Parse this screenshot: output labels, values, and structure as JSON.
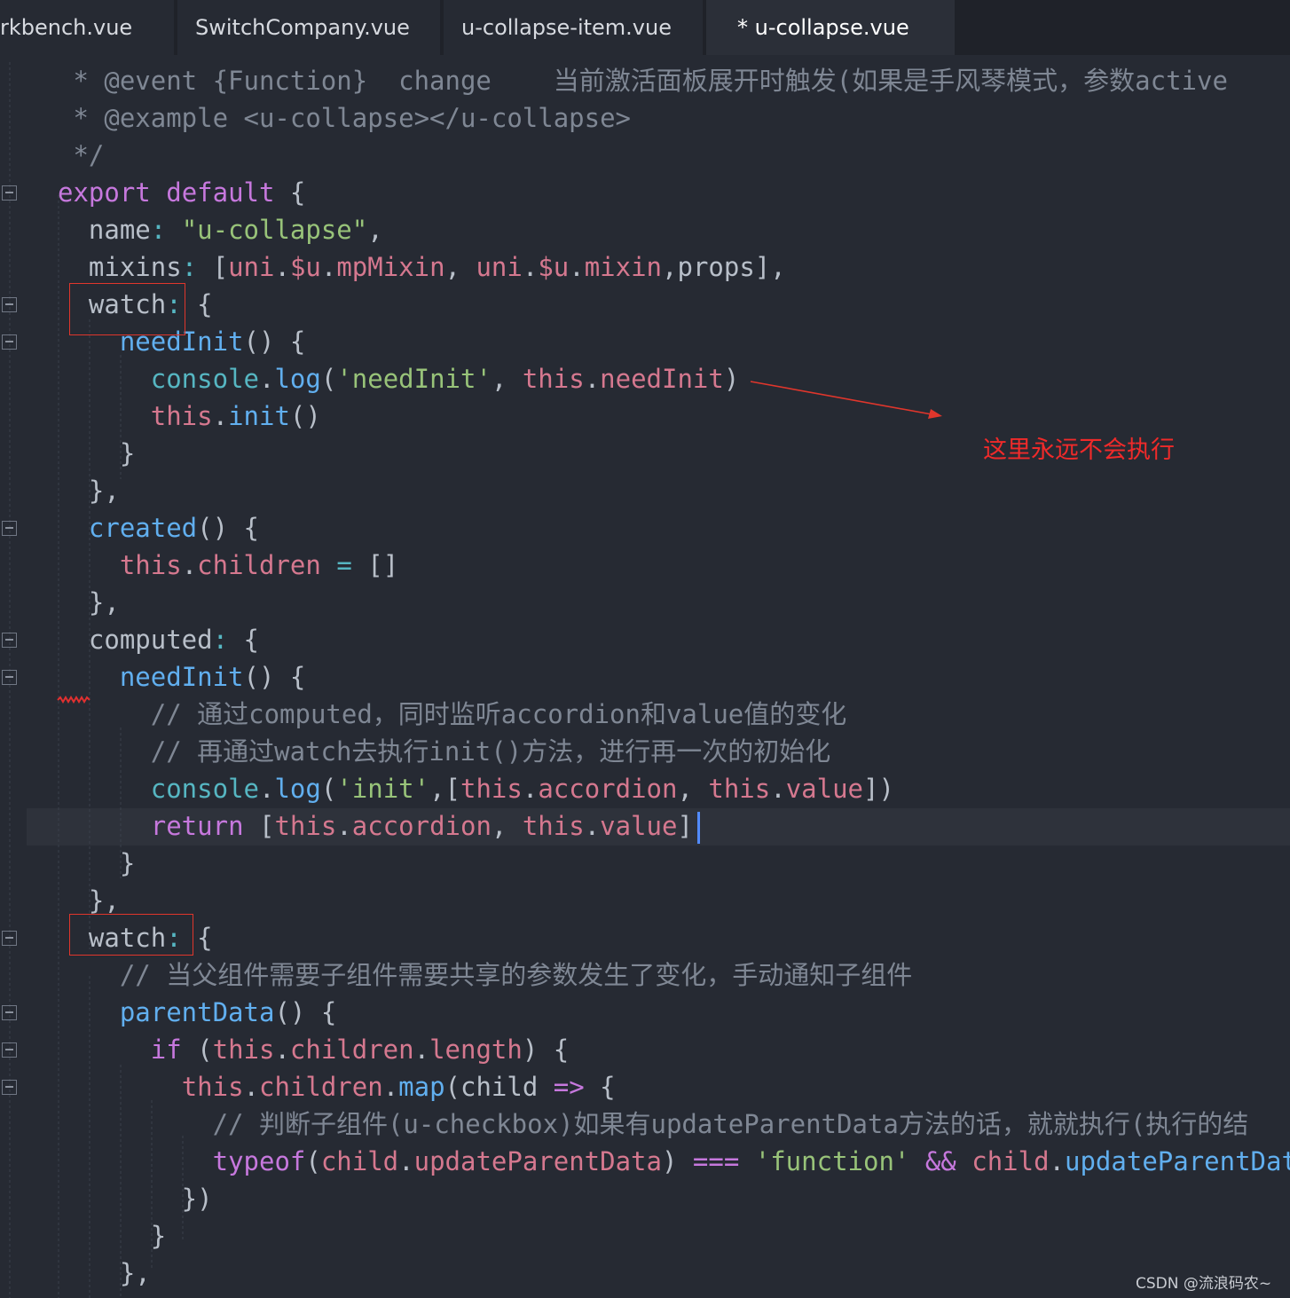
{
  "tabs": [
    {
      "label": "rkbench.vue",
      "active": false
    },
    {
      "label": "SwitchCompany.vue",
      "active": false
    },
    {
      "label": "u-collapse-item.vue",
      "active": false
    },
    {
      "label": "* u-collapse.vue",
      "active": true
    }
  ],
  "code_lines": [
    [
      [
        "com",
        " * @event {Function}  change    当前激活面板展开时触发(如果是手风琴模式，参数active"
      ]
    ],
    [
      [
        "com",
        " * @example <u-collapse></u-collapse>"
      ]
    ],
    [
      [
        "com",
        " */"
      ]
    ],
    [
      [
        "kw",
        "export"
      ],
      [
        "plain",
        " "
      ],
      [
        "kw",
        "default"
      ],
      [
        "plain",
        " {"
      ]
    ],
    [
      [
        "plain",
        "  name"
      ],
      [
        "cyan",
        ":"
      ],
      [
        "plain",
        " "
      ],
      [
        "str",
        "\"u-collapse\""
      ],
      [
        "plain",
        ","
      ]
    ],
    [
      [
        "plain",
        "  mixins"
      ],
      [
        "cyan",
        ":"
      ],
      [
        "plain",
        " ["
      ],
      [
        "var",
        "uni"
      ],
      [
        "plain",
        "."
      ],
      [
        "var",
        "$u"
      ],
      [
        "plain",
        "."
      ],
      [
        "var",
        "mpMixin"
      ],
      [
        "plain",
        ", "
      ],
      [
        "var",
        "uni"
      ],
      [
        "plain",
        "."
      ],
      [
        "var",
        "$u"
      ],
      [
        "plain",
        "."
      ],
      [
        "var",
        "mixin"
      ],
      [
        "plain",
        ",props],"
      ]
    ],
    [
      [
        "plain",
        "  watch"
      ],
      [
        "cyan",
        ":"
      ],
      [
        "plain",
        " {"
      ]
    ],
    [
      [
        "plain",
        "    "
      ],
      [
        "func",
        "needInit"
      ],
      [
        "plain",
        "() {"
      ]
    ],
    [
      [
        "plain",
        "      "
      ],
      [
        "cyan",
        "console"
      ],
      [
        "plain",
        "."
      ],
      [
        "func",
        "log"
      ],
      [
        "plain",
        "("
      ],
      [
        "str",
        "'needInit'"
      ],
      [
        "plain",
        ", "
      ],
      [
        "var",
        "this"
      ],
      [
        "plain",
        "."
      ],
      [
        "var",
        "needInit"
      ],
      [
        "plain",
        ")"
      ]
    ],
    [
      [
        "plain",
        "      "
      ],
      [
        "var",
        "this"
      ],
      [
        "plain",
        "."
      ],
      [
        "func",
        "init"
      ],
      [
        "plain",
        "()"
      ]
    ],
    [
      [
        "plain",
        "    }"
      ]
    ],
    [
      [
        "plain",
        "  },"
      ]
    ],
    [
      [
        "plain",
        "  "
      ],
      [
        "func",
        "created"
      ],
      [
        "plain",
        "() {"
      ]
    ],
    [
      [
        "plain",
        "    "
      ],
      [
        "var",
        "this"
      ],
      [
        "plain",
        "."
      ],
      [
        "var",
        "children"
      ],
      [
        "plain",
        " "
      ],
      [
        "cyan",
        "="
      ],
      [
        "plain",
        " []"
      ]
    ],
    [
      [
        "plain",
        "  },"
      ]
    ],
    [
      [
        "plain",
        "  computed"
      ],
      [
        "cyan",
        ":"
      ],
      [
        "plain",
        " {"
      ]
    ],
    [
      [
        "plain",
        "    "
      ],
      [
        "func",
        "needInit"
      ],
      [
        "plain",
        "() {"
      ]
    ],
    [
      [
        "com",
        "      // 通过computed，同时监听accordion和value值的变化"
      ]
    ],
    [
      [
        "com",
        "      // 再通过watch去执行init()方法，进行再一次的初始化"
      ]
    ],
    [
      [
        "plain",
        "      "
      ],
      [
        "cyan",
        "console"
      ],
      [
        "plain",
        "."
      ],
      [
        "func",
        "log"
      ],
      [
        "plain",
        "("
      ],
      [
        "str",
        "'init'"
      ],
      [
        "plain",
        ",["
      ],
      [
        "var",
        "this"
      ],
      [
        "plain",
        "."
      ],
      [
        "var",
        "accordion"
      ],
      [
        "plain",
        ", "
      ],
      [
        "var",
        "this"
      ],
      [
        "plain",
        "."
      ],
      [
        "var",
        "value"
      ],
      [
        "plain",
        "])"
      ]
    ],
    [
      [
        "plain",
        "      "
      ],
      [
        "kw",
        "return"
      ],
      [
        "plain",
        " ["
      ],
      [
        "var",
        "this"
      ],
      [
        "plain",
        "."
      ],
      [
        "var",
        "accordion"
      ],
      [
        "plain",
        ", "
      ],
      [
        "var",
        "this"
      ],
      [
        "plain",
        "."
      ],
      [
        "var",
        "value"
      ],
      [
        "plain",
        "]"
      ]
    ],
    [
      [
        "plain",
        "    }"
      ]
    ],
    [
      [
        "plain",
        "  },"
      ]
    ],
    [
      [
        "plain",
        "  watch"
      ],
      [
        "cyan",
        ":"
      ],
      [
        "plain",
        " {"
      ]
    ],
    [
      [
        "com",
        "    // 当父组件需要子组件需要共享的参数发生了变化，手动通知子组件"
      ]
    ],
    [
      [
        "plain",
        "    "
      ],
      [
        "func",
        "parentData"
      ],
      [
        "plain",
        "() {"
      ]
    ],
    [
      [
        "plain",
        "      "
      ],
      [
        "kw",
        "if"
      ],
      [
        "plain",
        " ("
      ],
      [
        "var",
        "this"
      ],
      [
        "plain",
        "."
      ],
      [
        "var",
        "children"
      ],
      [
        "plain",
        "."
      ],
      [
        "var",
        "length"
      ],
      [
        "plain",
        ") {"
      ]
    ],
    [
      [
        "plain",
        "        "
      ],
      [
        "var",
        "this"
      ],
      [
        "plain",
        "."
      ],
      [
        "var",
        "children"
      ],
      [
        "plain",
        "."
      ],
      [
        "func",
        "map"
      ],
      [
        "plain",
        "(child "
      ],
      [
        "op",
        "=>"
      ],
      [
        "plain",
        " {"
      ]
    ],
    [
      [
        "com",
        "          // 判断子组件(u-checkbox)如果有updateParentData方法的话，就就执行(执行的结"
      ]
    ],
    [
      [
        "plain",
        "          "
      ],
      [
        "kw",
        "typeof"
      ],
      [
        "plain",
        "("
      ],
      [
        "var",
        "child"
      ],
      [
        "plain",
        "."
      ],
      [
        "var",
        "updateParentData"
      ],
      [
        "plain",
        ") "
      ],
      [
        "op",
        "==="
      ],
      [
        "plain",
        " "
      ],
      [
        "str",
        "'function'"
      ],
      [
        "plain",
        " "
      ],
      [
        "op",
        "&&"
      ],
      [
        "plain",
        " "
      ],
      [
        "var",
        "child"
      ],
      [
        "plain",
        "."
      ],
      [
        "func",
        "updateParentData"
      ],
      [
        "plain",
        "()"
      ]
    ],
    [
      [
        "plain",
        "        })"
      ]
    ],
    [
      [
        "plain",
        "      }"
      ]
    ],
    [
      [
        "plain",
        "    },"
      ]
    ]
  ],
  "annotation": {
    "text": "这里永远不会执行",
    "color": "#f02a2a"
  },
  "watermark": "CSDN @流浪码农~",
  "colors": {
    "background": "#262a33",
    "keyword": "#c678dd",
    "function": "#61afef",
    "variable": "#d5788f",
    "string": "#98c379",
    "comment": "#7f8794",
    "highlight_box": "#e0362c",
    "caret": "#528bff"
  }
}
